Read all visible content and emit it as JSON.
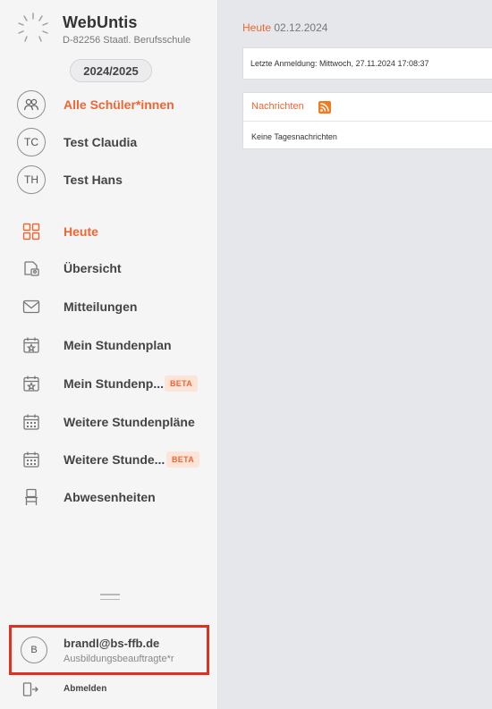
{
  "app": {
    "title": "WebUntis",
    "school": "D-82256 Staatl. Berufsschule",
    "school_year": "2024/2025"
  },
  "students": [
    {
      "initials": "",
      "label": "Alle Schüler*innen",
      "icon": "group-icon",
      "active": true
    },
    {
      "initials": "TC",
      "label": "Test Claudia",
      "active": false
    },
    {
      "initials": "TH",
      "label": "Test Hans",
      "active": false
    }
  ],
  "nav": [
    {
      "label": "Heute",
      "icon": "dashboard-grid-icon",
      "active": true,
      "badge": ""
    },
    {
      "label": "Übersicht",
      "icon": "overview-icon",
      "active": false,
      "badge": ""
    },
    {
      "label": "Mitteilungen",
      "icon": "envelope-icon",
      "active": false,
      "badge": ""
    },
    {
      "label": "Mein Stundenplan",
      "icon": "calendar-star-icon",
      "active": false,
      "badge": ""
    },
    {
      "label": "Mein Stundenp...",
      "icon": "calendar-star-icon",
      "active": false,
      "badge": "BETA"
    },
    {
      "label": "Weitere Stundenpläne",
      "icon": "calendar-grid-icon",
      "active": false,
      "badge": ""
    },
    {
      "label": "Weitere Stunde...",
      "icon": "calendar-grid-icon",
      "active": false,
      "badge": "BETA"
    },
    {
      "label": "Abwesenheiten",
      "icon": "chair-icon",
      "active": false,
      "badge": ""
    }
  ],
  "user": {
    "initial": "B",
    "email": "brandl@bs-ffb.de",
    "role": "Ausbildungsbeauftragte*r"
  },
  "logout_label": "Abmelden",
  "main": {
    "heute_label": "Heute",
    "date": "02.12.2024",
    "last_login": "Letzte Anmeldung: Mittwoch, 27.11.2024 17:08:37",
    "news_title": "Nachrichten",
    "news_empty": "Keine Tagesnachrichten"
  },
  "colors": {
    "accent": "#f06632",
    "highlight_border": "#e03020"
  }
}
